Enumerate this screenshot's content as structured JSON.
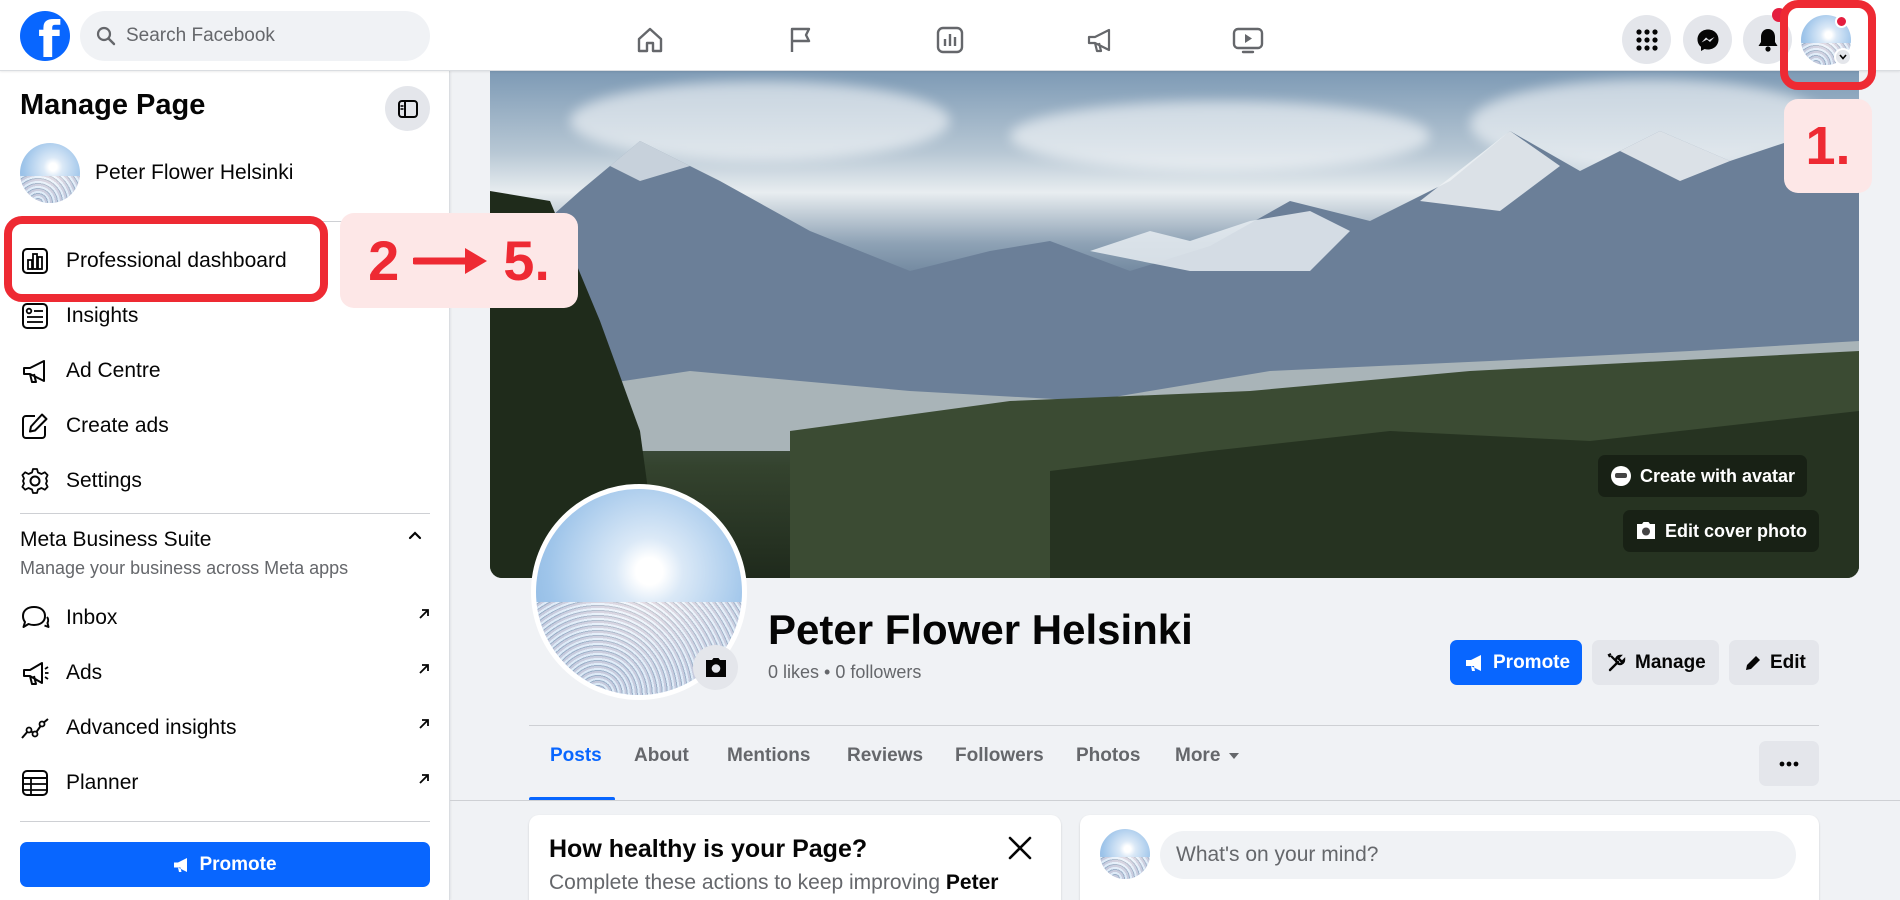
{
  "topbar": {
    "logo": "f",
    "search_placeholder": "Search Facebook",
    "nav_icons": [
      "home-icon",
      "flag-icon",
      "dashboard-icon",
      "megaphone-icon",
      "video-icon"
    ],
    "right_icons": [
      "menu-grid-icon",
      "messenger-icon",
      "bell-icon",
      "profile-avatar"
    ]
  },
  "sidebar": {
    "title": "Manage Page",
    "page_name": "Peter Flower Helsinki",
    "items": [
      {
        "label": "Professional dashboard",
        "icon": "dashboard-icon"
      },
      {
        "label": "Insights",
        "icon": "insights-icon"
      },
      {
        "label": "Ad Centre",
        "icon": "megaphone-icon"
      },
      {
        "label": "Create ads",
        "icon": "edit-icon"
      },
      {
        "label": "Settings",
        "icon": "gear-icon"
      }
    ],
    "mbs_title": "Meta Business Suite",
    "mbs_subtitle": "Manage your business across Meta apps",
    "mbs_items": [
      {
        "label": "Inbox",
        "icon": "chat-icon"
      },
      {
        "label": "Ads",
        "icon": "megaphone-icon"
      },
      {
        "label": "Advanced insights",
        "icon": "trend-icon"
      },
      {
        "label": "Planner",
        "icon": "calendar-icon"
      }
    ],
    "promote_label": "Promote"
  },
  "annotations": {
    "step1": "1.",
    "step2_left": "2",
    "step2_right": "5."
  },
  "cover": {
    "create_avatar": "Create with avatar",
    "edit_cover": "Edit cover photo"
  },
  "profile": {
    "name": "Peter Flower Helsinki",
    "stats": "0 likes • 0 followers",
    "buttons": {
      "promote": "Promote",
      "manage": "Manage",
      "edit": "Edit"
    }
  },
  "tabs": [
    "Posts",
    "About",
    "Mentions",
    "Reviews",
    "Followers",
    "Photos",
    "More"
  ],
  "health_card": {
    "title": "How healthy is your Page?",
    "subtitle_start": "Complete these actions to keep improving ",
    "subtitle_bold": "Peter"
  },
  "composer": {
    "placeholder": "What's on your mind?"
  },
  "colors": {
    "brand": "#0866ff",
    "annotation": "#ee2a33",
    "annotation_bg": "#fde7e7",
    "text_secondary": "#65676b"
  }
}
